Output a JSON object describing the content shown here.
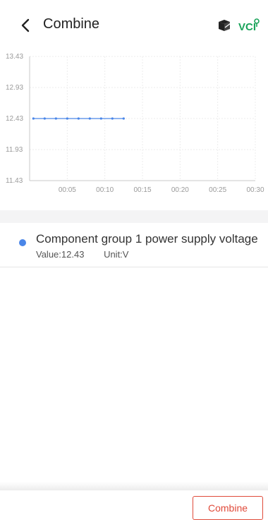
{
  "header": {
    "title": "Combine",
    "back_icon": "chevron-left-icon",
    "right_icons": [
      "box-icon",
      "vci-status-icon"
    ],
    "vci_label": "VCI",
    "accent_color": "#1aa35a"
  },
  "chart_data": {
    "type": "line",
    "x_ticks": [
      "00:05",
      "00:10",
      "00:15",
      "00:20",
      "00:25",
      "00:30"
    ],
    "y_ticks": [
      "13.43",
      "12.93",
      "12.43",
      "11.93",
      "11.43"
    ],
    "ylim": [
      11.43,
      13.43
    ],
    "xlim": [
      0,
      30
    ],
    "grid": true,
    "series": [
      {
        "name": "Component group 1 power supply voltage",
        "color": "#4a86e8",
        "x": [
          0.5,
          2,
          3.5,
          5,
          6.5,
          8,
          9.5,
          11,
          12.5
        ],
        "y": [
          12.43,
          12.43,
          12.43,
          12.43,
          12.43,
          12.43,
          12.43,
          12.43,
          12.43
        ]
      }
    ]
  },
  "items": [
    {
      "name": "Component group 1 power supply voltage",
      "value_text": "Value:12.43",
      "unit_text": "Unit:V",
      "dot_color": "#4a86e8"
    }
  ],
  "footer": {
    "combine_label": "Combine",
    "button_color": "#e04a3a"
  }
}
